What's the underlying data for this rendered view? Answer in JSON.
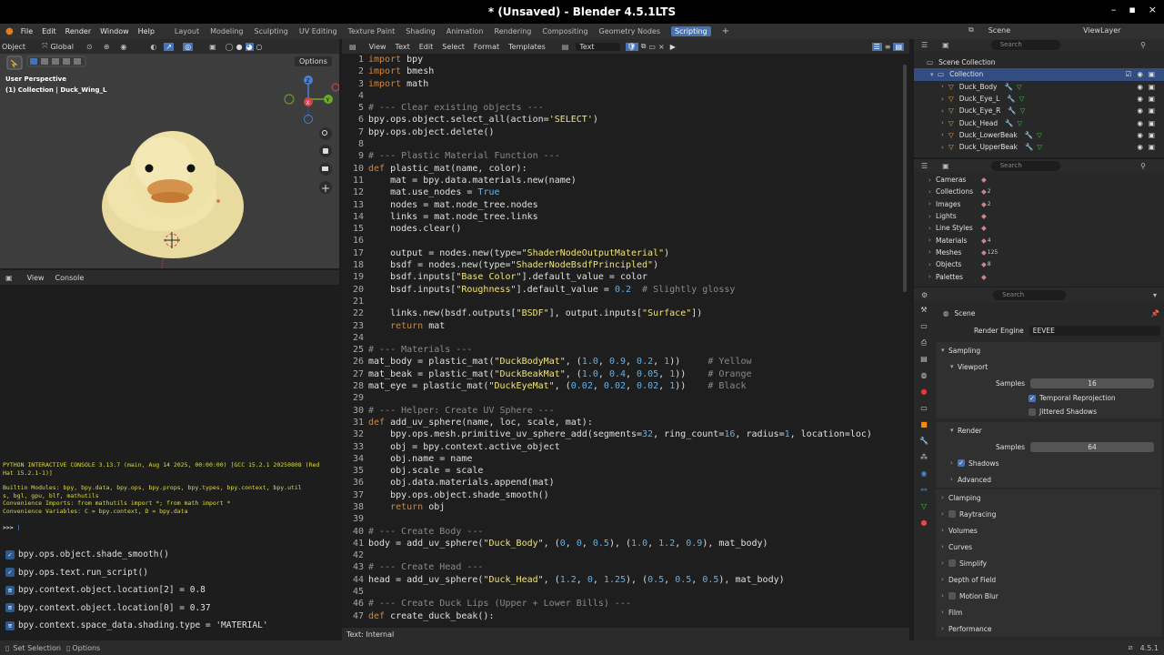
{
  "titlebar": {
    "title": "* (Unsaved) - Blender 4.5.1LTS",
    "min": "–",
    "max": "▪",
    "close": "×"
  },
  "menu": [
    "File",
    "Edit",
    "Render",
    "Window",
    "Help"
  ],
  "workspaces": [
    {
      "label": "Layout"
    },
    {
      "label": "Modeling"
    },
    {
      "label": "Sculpting"
    },
    {
      "label": "UV Editing"
    },
    {
      "label": "Texture Paint"
    },
    {
      "label": "Shading"
    },
    {
      "label": "Animation"
    },
    {
      "label": "Rendering"
    },
    {
      "label": "Compositing"
    },
    {
      "label": "Geometry Nodes"
    },
    {
      "label": "Scripting",
      "active": true
    }
  ],
  "viewport": {
    "mode": "Object",
    "orientation": "Global",
    "options": "Options",
    "perspective": "User Perspective",
    "collection": "(1) Collection | Duck_Wing_L",
    "gizmo": {
      "x": "X",
      "y": "Y",
      "z": "Z"
    }
  },
  "console": {
    "menu": [
      "View",
      "Console"
    ],
    "lines": [
      "PYTHON INTERACTIVE CONSOLE 3.13.7 (main, Aug 14 2025, 00:00:00) [GCC 15.2.1 20250808 (Red",
      "Hat 15.2.1-1)]",
      "",
      "Builtin Modules:       bpy, bpy.data, bpy.ops, bpy.props, bpy.types, bpy.context, bpy.util",
      "s, bgl, gpu, blf, mathutils",
      "Convenience Imports:   from mathutils import *; from math import *",
      "Convenience Variables: C = bpy.context, D = bpy.data"
    ],
    "prompt": ">>> "
  },
  "history": [
    "bpy.ops.object.shade_smooth()",
    "bpy.ops.text.run_script()",
    "bpy.context.object.location[2] = 0.8",
    "bpy.context.object.location[0] = 0.37",
    "bpy.context.space_data.shading.type = 'MATERIAL'"
  ],
  "texteditor": {
    "menu": [
      "View",
      "Text",
      "Edit",
      "Select",
      "Format",
      "Templates"
    ],
    "textname": "Text",
    "footer": "Text: Internal"
  },
  "code": [
    [
      [
        "kw",
        "import"
      ],
      [
        "tx",
        " bpy"
      ]
    ],
    [
      [
        "kw",
        "import"
      ],
      [
        "tx",
        " bmesh"
      ]
    ],
    [
      [
        "kw",
        "import"
      ],
      [
        "tx",
        " math"
      ]
    ],
    [],
    [
      [
        "cm",
        "# --- Clear existing objects ---"
      ]
    ],
    [
      [
        "tx",
        "bpy.ops.object.select_all(action="
      ],
      [
        "st",
        "'SELECT'"
      ],
      [
        "tx",
        ")"
      ]
    ],
    [
      [
        "tx",
        "bpy.ops.object.delete()"
      ]
    ],
    [],
    [
      [
        "cm",
        "# --- Plastic Material Function ---"
      ]
    ],
    [
      [
        "kw",
        "def"
      ],
      [
        "tx",
        " plastic_mat(name, color):"
      ]
    ],
    [
      [
        "tx",
        "    mat = bpy.data.materials.new(name)"
      ]
    ],
    [
      [
        "tx",
        "    mat.use_nodes = "
      ],
      [
        "nu",
        "True"
      ]
    ],
    [
      [
        "tx",
        "    nodes = mat.node_tree.nodes"
      ]
    ],
    [
      [
        "tx",
        "    links = mat.node_tree.links"
      ]
    ],
    [
      [
        "tx",
        "    nodes.clear()"
      ]
    ],
    [],
    [
      [
        "tx",
        "    output = nodes.new(type="
      ],
      [
        "st",
        "\"ShaderNodeOutputMaterial\""
      ],
      [
        "tx",
        ")"
      ]
    ],
    [
      [
        "tx",
        "    bsdf = nodes.new(type="
      ],
      [
        "st",
        "\"ShaderNodeBsdfPrincipled\""
      ],
      [
        "tx",
        ")"
      ]
    ],
    [
      [
        "tx",
        "    bsdf.inputs["
      ],
      [
        "st",
        "\"Base Color\""
      ],
      [
        "tx",
        "].default_value = color"
      ]
    ],
    [
      [
        "tx",
        "    bsdf.inputs["
      ],
      [
        "st",
        "\"Roughness\""
      ],
      [
        "tx",
        "].default_value = "
      ],
      [
        "nu",
        "0.2"
      ],
      [
        "cm",
        "  # Slightly glossy"
      ]
    ],
    [],
    [
      [
        "tx",
        "    links.new(bsdf.outputs["
      ],
      [
        "st",
        "\"BSDF\""
      ],
      [
        "tx",
        "], output.inputs["
      ],
      [
        "st",
        "\"Surface\""
      ],
      [
        "tx",
        "])"
      ]
    ],
    [
      [
        "kw",
        "    return"
      ],
      [
        "tx",
        " mat"
      ]
    ],
    [],
    [
      [
        "cm",
        "# --- Materials ---"
      ]
    ],
    [
      [
        "tx",
        "mat_body = plastic_mat("
      ],
      [
        "st",
        "\"DuckBodyMat\""
      ],
      [
        "tx",
        ", ("
      ],
      [
        "nu",
        "1.0"
      ],
      [
        "tx",
        ", "
      ],
      [
        "nu",
        "0.9"
      ],
      [
        "tx",
        ", "
      ],
      [
        "nu",
        "0.2"
      ],
      [
        "tx",
        ", "
      ],
      [
        "nu",
        "1"
      ],
      [
        "tx",
        "))     "
      ],
      [
        "cm",
        "# Yellow"
      ]
    ],
    [
      [
        "tx",
        "mat_beak = plastic_mat("
      ],
      [
        "st",
        "\"DuckBeakMat\""
      ],
      [
        "tx",
        ", ("
      ],
      [
        "nu",
        "1.0"
      ],
      [
        "tx",
        ", "
      ],
      [
        "nu",
        "0.4"
      ],
      [
        "tx",
        ", "
      ],
      [
        "nu",
        "0.05"
      ],
      [
        "tx",
        ", "
      ],
      [
        "nu",
        "1"
      ],
      [
        "tx",
        "))    "
      ],
      [
        "cm",
        "# Orange"
      ]
    ],
    [
      [
        "tx",
        "mat_eye = plastic_mat("
      ],
      [
        "st",
        "\"DuckEyeMat\""
      ],
      [
        "tx",
        ", ("
      ],
      [
        "nu",
        "0.02"
      ],
      [
        "tx",
        ", "
      ],
      [
        "nu",
        "0.02"
      ],
      [
        "tx",
        ", "
      ],
      [
        "nu",
        "0.02"
      ],
      [
        "tx",
        ", "
      ],
      [
        "nu",
        "1"
      ],
      [
        "tx",
        "))    "
      ],
      [
        "cm",
        "# Black"
      ]
    ],
    [],
    [
      [
        "cm",
        "# --- Helper: Create UV Sphere ---"
      ]
    ],
    [
      [
        "kw",
        "def"
      ],
      [
        "tx",
        " add_uv_sphere(name, loc, scale, mat):"
      ]
    ],
    [
      [
        "tx",
        "    bpy.ops.mesh.primitive_uv_sphere_add(segments="
      ],
      [
        "nu",
        "32"
      ],
      [
        "tx",
        ", ring_count="
      ],
      [
        "nu",
        "16"
      ],
      [
        "tx",
        ", radius="
      ],
      [
        "nu",
        "1"
      ],
      [
        "tx",
        ", location=loc)"
      ]
    ],
    [
      [
        "tx",
        "    obj = bpy.context.active_object"
      ]
    ],
    [
      [
        "tx",
        "    obj.name = name"
      ]
    ],
    [
      [
        "tx",
        "    obj.scale = scale"
      ]
    ],
    [
      [
        "tx",
        "    obj.data.materials.append(mat)"
      ]
    ],
    [
      [
        "tx",
        "    bpy.ops.object.shade_smooth()"
      ]
    ],
    [
      [
        "kw",
        "    return"
      ],
      [
        "tx",
        " obj"
      ]
    ],
    [],
    [
      [
        "cm",
        "# --- Create Body ---"
      ]
    ],
    [
      [
        "tx",
        "body = add_uv_sphere("
      ],
      [
        "st",
        "\"Duck_Body\""
      ],
      [
        "tx",
        ", ("
      ],
      [
        "nu",
        "0"
      ],
      [
        "tx",
        ", "
      ],
      [
        "nu",
        "0"
      ],
      [
        "tx",
        ", "
      ],
      [
        "nu",
        "0.5"
      ],
      [
        "tx",
        "), ("
      ],
      [
        "nu",
        "1.0"
      ],
      [
        "tx",
        ", "
      ],
      [
        "nu",
        "1.2"
      ],
      [
        "tx",
        ", "
      ],
      [
        "nu",
        "0.9"
      ],
      [
        "tx",
        "), mat_body)"
      ]
    ],
    [],
    [
      [
        "cm",
        "# --- Create Head ---"
      ]
    ],
    [
      [
        "tx",
        "head = add_uv_sphere("
      ],
      [
        "st",
        "\"Duck_Head\""
      ],
      [
        "tx",
        ", ("
      ],
      [
        "nu",
        "1.2"
      ],
      [
        "tx",
        ", "
      ],
      [
        "nu",
        "0"
      ],
      [
        "tx",
        ", "
      ],
      [
        "nu",
        "1.25"
      ],
      [
        "tx",
        "), ("
      ],
      [
        "nu",
        "0.5"
      ],
      [
        "tx",
        ", "
      ],
      [
        "nu",
        "0.5"
      ],
      [
        "tx",
        ", "
      ],
      [
        "nu",
        "0.5"
      ],
      [
        "tx",
        "), mat_body)"
      ]
    ],
    [],
    [
      [
        "cm",
        "# --- Create Duck Lips (Upper + Lower Bills) ---"
      ]
    ],
    [
      [
        "kw",
        "def"
      ],
      [
        "tx",
        " create_duck_beak():"
      ]
    ]
  ],
  "outliner": {
    "scene": "Scene",
    "viewlayer": "ViewLayer",
    "search": "Search",
    "root": "Scene Collection",
    "collection": "Collection",
    "items": [
      "Duck_Body",
      "Duck_Eye_L",
      "Duck_Eye_R",
      "Duck_Head",
      "Duck_LowerBeak",
      "Duck_UpperBeak"
    ]
  },
  "datablocks": {
    "search": "Search",
    "items": [
      {
        "label": "Cameras"
      },
      {
        "label": "Collections",
        "count": "2"
      },
      {
        "label": "Images",
        "count": "2"
      },
      {
        "label": "Lights"
      },
      {
        "label": "Line Styles"
      },
      {
        "label": "Materials",
        "count": "4"
      },
      {
        "label": "Meshes",
        "count": "125"
      },
      {
        "label": "Objects",
        "count": "8"
      },
      {
        "label": "Palettes"
      }
    ]
  },
  "properties": {
    "search": "Search",
    "context": "Scene",
    "render_engine_label": "Render Engine",
    "render_engine": "EEVEE",
    "sampling": "Sampling",
    "viewport": "Viewport",
    "samples_label": "Samples",
    "viewport_samples": "16",
    "temporal": "Temporal Reprojection",
    "jittered": "Jittered Shadows",
    "render": "Render",
    "render_samples": "64",
    "shadows": "Shadows",
    "advanced": "Advanced",
    "sections": [
      "Clamping",
      "Raytracing",
      "Volumes",
      "Curves",
      "Simplify",
      "Depth of Field",
      "Motion Blur",
      "Film",
      "Performance"
    ]
  },
  "statusbar": {
    "left1": "Set Selection",
    "left2": "Options",
    "version": "4.5.1"
  }
}
